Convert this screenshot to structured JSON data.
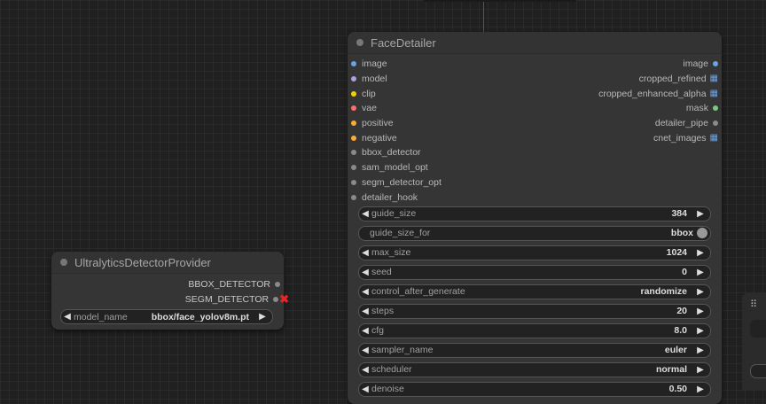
{
  "colors": {
    "image": "#6aa3e6",
    "model": "#b39ddb",
    "clip": "#f2d200",
    "vae": "#ff6e6e",
    "positive": "#ffa931",
    "negative": "#ffa931",
    "generic": "#8a8a8a",
    "mask": "#81c784"
  },
  "face_detailer": {
    "title": "FaceDetailer",
    "inputs": [
      {
        "label": "image",
        "color": "#6aa3e6"
      },
      {
        "label": "model",
        "color": "#b39ddb"
      },
      {
        "label": "clip",
        "color": "#f2d200"
      },
      {
        "label": "vae",
        "color": "#ff6e6e"
      },
      {
        "label": "positive",
        "color": "#ffa931"
      },
      {
        "label": "negative",
        "color": "#ffa931"
      },
      {
        "label": "bbox_detector",
        "color": "#8a8a8a"
      },
      {
        "label": "sam_model_opt",
        "color": "#8a8a8a"
      },
      {
        "label": "segm_detector_opt",
        "color": "#8a8a8a"
      },
      {
        "label": "detailer_hook",
        "color": "#8a8a8a"
      }
    ],
    "outputs": [
      {
        "label": "image",
        "color": "#6aa3e6",
        "icon": "dot"
      },
      {
        "label": "cropped_refined",
        "color": "#6aa3e6",
        "icon": "grid"
      },
      {
        "label": "cropped_enhanced_alpha",
        "color": "#6aa3e6",
        "icon": "grid"
      },
      {
        "label": "mask",
        "color": "#81c784",
        "icon": "dot"
      },
      {
        "label": "detailer_pipe",
        "color": "#8a8a8a",
        "icon": "dot"
      },
      {
        "label": "cnet_images",
        "color": "#6aa3e6",
        "icon": "grid"
      }
    ],
    "widgets": [
      {
        "label": "guide_size",
        "value": "384",
        "type": "number"
      },
      {
        "label": "guide_size_for",
        "value": "bbox",
        "type": "toggle"
      },
      {
        "label": "max_size",
        "value": "1024",
        "type": "number"
      },
      {
        "label": "seed",
        "value": "0",
        "type": "number"
      },
      {
        "label": "control_after_generate",
        "value": "randomize",
        "type": "combo"
      },
      {
        "label": "steps",
        "value": "20",
        "type": "number"
      },
      {
        "label": "cfg",
        "value": "8.0",
        "type": "number"
      },
      {
        "label": "sampler_name",
        "value": "euler",
        "type": "combo"
      },
      {
        "label": "scheduler",
        "value": "normal",
        "type": "combo"
      },
      {
        "label": "denoise",
        "value": "0.50",
        "type": "number"
      }
    ]
  },
  "ultralytics": {
    "title": "UltralyticsDetectorProvider",
    "outputs": [
      {
        "label": "BBOX_DETECTOR"
      },
      {
        "label": "SEGM_DETECTOR"
      }
    ],
    "widget": {
      "label": "model_name",
      "value": "bbox/face_yolov8m.pt"
    }
  },
  "side_panel": {
    "grip_icon": "grip-dots-icon"
  }
}
